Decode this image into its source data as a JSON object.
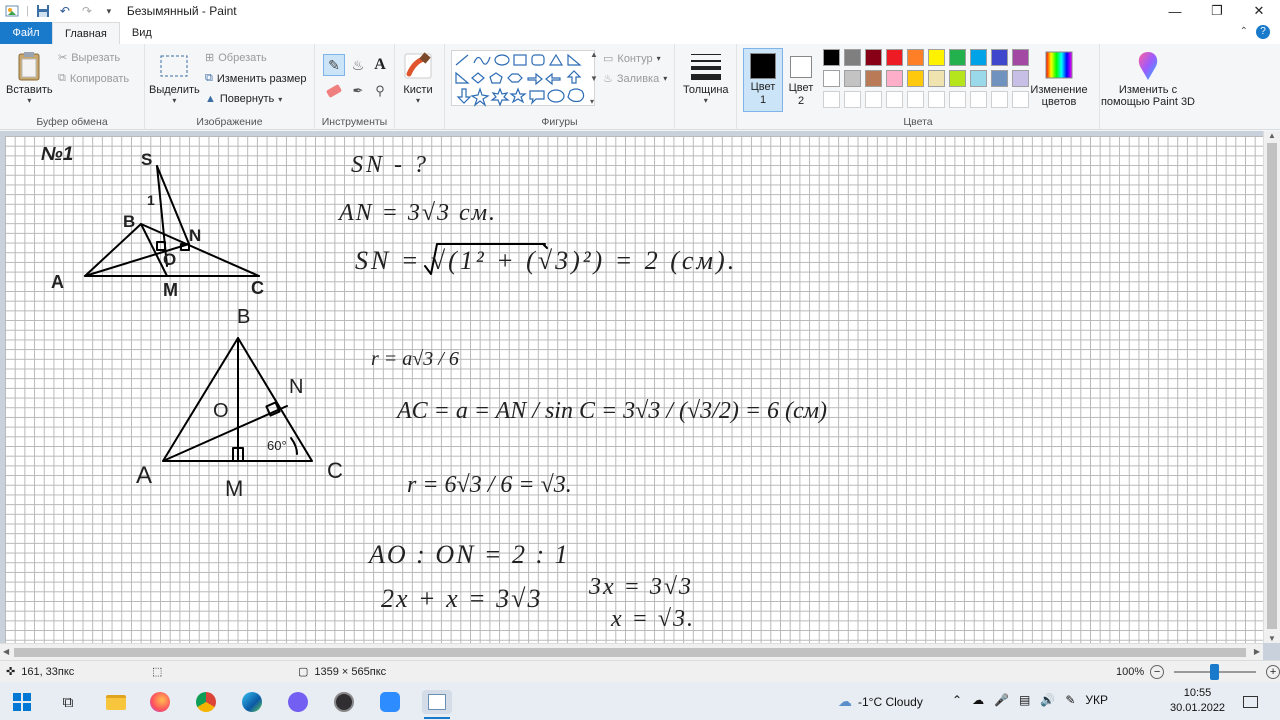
{
  "window": {
    "title": "Безымянный - Paint"
  },
  "tabs": {
    "file": "Файл",
    "home": "Главная",
    "view": "Вид"
  },
  "ribbon": {
    "clipboard": {
      "label": "Буфер обмена",
      "paste": "Вставить",
      "cut": "Вырезать",
      "copy": "Копировать"
    },
    "image": {
      "label": "Изображение",
      "select": "Выделить",
      "crop": "Обрезать",
      "resize": "Изменить размер",
      "rotate": "Повернуть"
    },
    "tools": {
      "label": "Инструменты"
    },
    "brushes": {
      "label": "Кисти"
    },
    "shapes": {
      "label": "Фигуры",
      "outline": "Контур",
      "fill": "Заливка"
    },
    "size": {
      "label": "Толщина"
    },
    "colors": {
      "label": "Цвета",
      "color1": "Цвет 1",
      "color2": "Цвет 2",
      "edit": "Изменение цветов",
      "paint3d": "Изменить с помощью Paint 3D",
      "palette_row1": [
        "#000000",
        "#7f7f7f",
        "#880015",
        "#ed1c24",
        "#ff7f27",
        "#fff200",
        "#22b14c",
        "#00a2e8",
        "#3f48cc",
        "#a349a4"
      ],
      "palette_row2": [
        "#ffffff",
        "#c3c3c3",
        "#b97a57",
        "#ffaec9",
        "#ffc90e",
        "#efe4b0",
        "#b5e61d",
        "#99d9ea",
        "#7092be",
        "#c8bfe7"
      ]
    }
  },
  "canvas": {
    "problem_number": "№1",
    "fig1": {
      "S": "S",
      "B": "B",
      "N": "N",
      "O": "O",
      "A": "A",
      "M": "M",
      "C": "C",
      "one": "1"
    },
    "fig2": {
      "B": "B",
      "N": "N",
      "O": "O",
      "A": "A",
      "M": "M",
      "C": "C",
      "angle": "60°"
    },
    "lines": [
      "SN - ?",
      "AN = 3√3 см.",
      "SN = √(1² + (√3)²) = 2 (см).",
      "r = a√3 / 6",
      "AC = a = AN / sin C = 3√3 / (√3/2) = 6 (см)",
      "r = 6√3 / 6 = √3.",
      "AO : ON = 2 : 1",
      "2x + x = 3√3",
      "3x = 3√3",
      "x = √3."
    ]
  },
  "status": {
    "cursor": "161, 33пкс",
    "size": "1359 × 565пкс",
    "zoom": "100%"
  },
  "taskbar": {
    "weather": "-1°C  Cloudy",
    "lang": "УКР",
    "time": "10:55",
    "date": "30.01.2022"
  }
}
